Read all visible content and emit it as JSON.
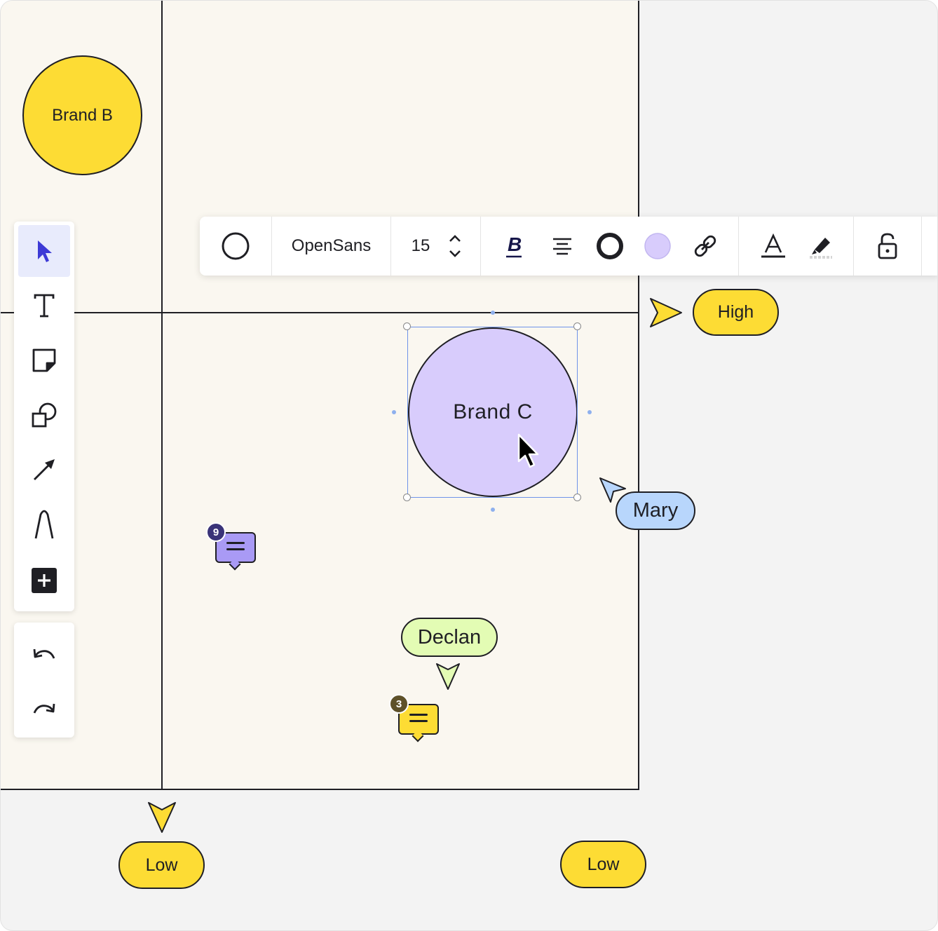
{
  "canvas": {
    "shapes": [
      {
        "label": "Brand B",
        "fill": "#fddc34"
      },
      {
        "label": "Brand C",
        "fill": "#d8ccfc"
      }
    ],
    "axis_tags": {
      "high": "High",
      "low_left": "Low",
      "low_right": "Low"
    },
    "collaborators": [
      {
        "name": "Mary",
        "color": "#b8d6fc"
      },
      {
        "name": "Declan",
        "color": "#e3fcb4"
      }
    ],
    "comments": [
      {
        "count": "9",
        "color": "#a99af5",
        "badge_color": "#3a3378"
      },
      {
        "count": "3",
        "color": "#fddc34",
        "badge_color": "#5e5129"
      }
    ]
  },
  "context_toolbar": {
    "font_family": "OpenSans",
    "font_size": "15",
    "fill_color": "#d8ccfc"
  },
  "left_toolbar": {
    "tools": [
      "select-icon",
      "text-icon",
      "sticky-note-icon",
      "shapes-icon",
      "arrow-icon",
      "pen-icon",
      "add-icon"
    ],
    "active": "select-icon",
    "history": [
      "undo-icon",
      "redo-icon"
    ]
  }
}
